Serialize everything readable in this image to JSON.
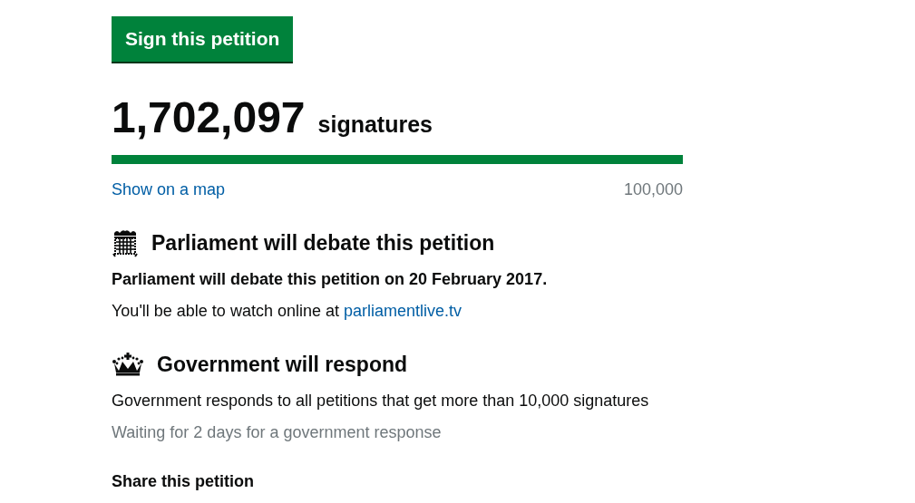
{
  "sign_button": {
    "label": "Sign this petition"
  },
  "signatures": {
    "count": "1,702,097",
    "label": "signatures",
    "level": 1,
    "map_link": "Show on a map",
    "threshold": "100,000"
  },
  "sections": [
    {
      "kind": "parliament",
      "heading": "Parliament will debate this petition",
      "lines": [
        {
          "kind": "bold",
          "text": "Parliament will debate this petition on 20 February 2017."
        },
        {
          "kind": "link",
          "text": "You'll be able to watch online at ",
          "link": "parliamentlive.tv"
        }
      ]
    },
    {
      "kind": "government",
      "heading": "Government will respond",
      "lines": [
        {
          "kind": "plain",
          "text": "Government responds to all petitions that get more than 10,000 signatures"
        },
        {
          "kind": "muted",
          "text": "Waiting for 2 days for a government response"
        }
      ]
    }
  ],
  "share": {
    "heading": "Share this petition"
  }
}
